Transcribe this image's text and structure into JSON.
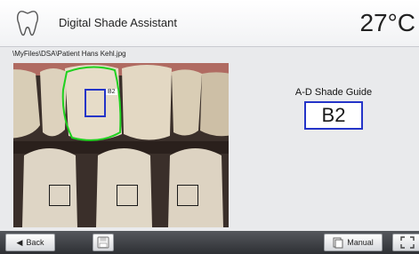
{
  "header": {
    "icon": "tooth-icon",
    "title": "Digital Shade Assistant",
    "temperature": "27°C"
  },
  "file_path": "\\MyFiles\\DSA\\Patient Hans Kehl.jpg",
  "photo": {
    "selected_tooth_shade_tag": "B2"
  },
  "shade_guide": {
    "label": "A-D Shade Guide",
    "value": "B2"
  },
  "toolbar": {
    "back_label": "Back",
    "back_icon": "chevron-left-icon",
    "save_icon": "floppy-disk-icon",
    "manual_label": "Manual",
    "manual_icon": "document-icon",
    "fullscreen_icon": "fullscreen-icon"
  },
  "colors": {
    "tooth_outline": "#1fd11f",
    "selection_box": "#2434c8",
    "shade_box_border": "#2434c8",
    "toolbar_bg": "#3a3c40"
  }
}
